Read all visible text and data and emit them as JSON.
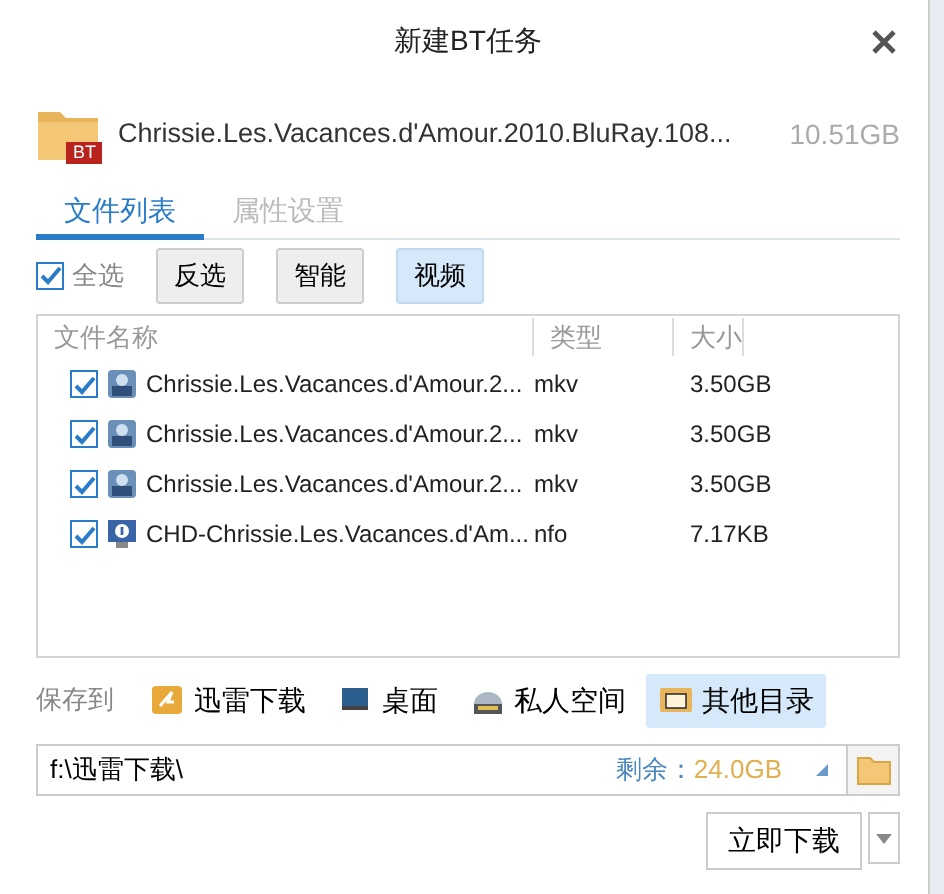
{
  "window": {
    "title": "新建BT任务"
  },
  "torrent": {
    "badge": "BT",
    "name": "Chrissie.Les.Vacances.d'Amour.2010.BluRay.108...",
    "size": "10.51GB"
  },
  "tabs": [
    {
      "label": "文件列表",
      "selected": true
    },
    {
      "label": "属性设置",
      "selected": false
    }
  ],
  "select_all": {
    "label": "全选",
    "checked": true
  },
  "filter_buttons": [
    {
      "label": "反选",
      "selected": false
    },
    {
      "label": "智能",
      "selected": false
    },
    {
      "label": "视频",
      "selected": true
    }
  ],
  "file_list": {
    "columns": [
      "文件名称",
      "类型",
      "大小"
    ],
    "rows": [
      {
        "kind": "video",
        "name": "Chrissie.Les.Vacances.d'Amour.2...",
        "type": "mkv",
        "size": "3.50GB",
        "checked": true
      },
      {
        "kind": "video",
        "name": "Chrissie.Les.Vacances.d'Amour.2...",
        "type": "mkv",
        "size": "3.50GB",
        "checked": true
      },
      {
        "kind": "video",
        "name": "Chrissie.Les.Vacances.d'Amour.2...",
        "type": "mkv",
        "size": "3.50GB",
        "checked": true
      },
      {
        "kind": "info",
        "name": "CHD-Chrissie.Les.Vacances.d'Am...",
        "type": "nfo",
        "size": "7.17KB",
        "checked": true
      }
    ]
  },
  "save_to": {
    "label": "保存到",
    "options": [
      {
        "kind": "thunder",
        "label": "迅雷下载",
        "selected": false
      },
      {
        "kind": "desktop",
        "label": "桌面",
        "selected": false
      },
      {
        "kind": "private",
        "label": "私人空间",
        "selected": false
      },
      {
        "kind": "other",
        "label": "其他目录",
        "selected": true
      }
    ]
  },
  "path": {
    "value": "f:\\迅雷下载\\",
    "free_label": "剩余：",
    "free_value": "24.0GB"
  },
  "download_button": "立即下载"
}
